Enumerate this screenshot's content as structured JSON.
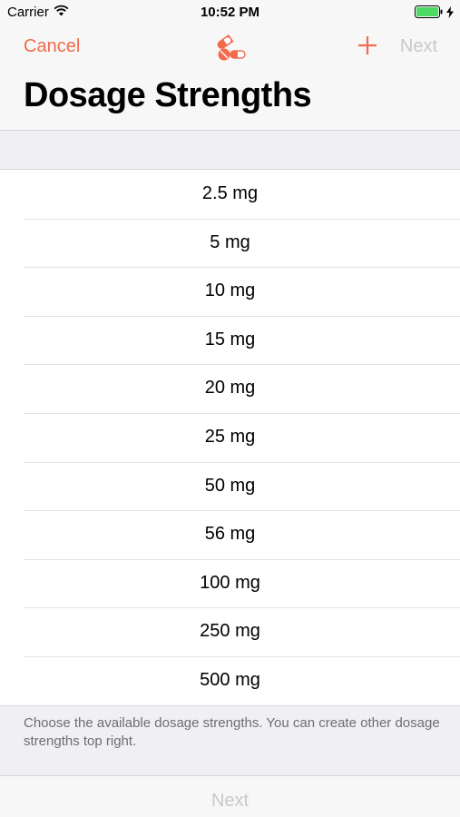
{
  "status_bar": {
    "carrier": "Carrier",
    "time": "10:52 PM",
    "battery_color": "#4cd964"
  },
  "nav": {
    "cancel_label": "Cancel",
    "center_icon": "pills-icon",
    "add_icon": "plus-icon",
    "next_label": "Next",
    "title": "Dosage Strengths"
  },
  "dosages": [
    {
      "label": "2.5 mg"
    },
    {
      "label": "5 mg"
    },
    {
      "label": "10 mg"
    },
    {
      "label": "15 mg"
    },
    {
      "label": "20 mg"
    },
    {
      "label": "25 mg"
    },
    {
      "label": "50 mg"
    },
    {
      "label": "56 mg"
    },
    {
      "label": "100 mg"
    },
    {
      "label": "250 mg"
    },
    {
      "label": "500 mg"
    }
  ],
  "footer_note": "Choose the available dosage strengths. You can create other dosage strengths top right.",
  "bottom": {
    "next_label": "Next"
  },
  "colors": {
    "accent": "#f26b4d",
    "disabled": "#c8c8cd",
    "secondary_text": "#6d6d72",
    "background": "#efeff4"
  }
}
